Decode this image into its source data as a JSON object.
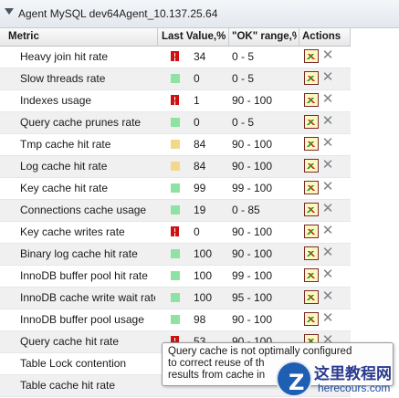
{
  "window": {
    "title": "Agent MySQL dev64Agent_10.137.25.64"
  },
  "table": {
    "headers": {
      "metric": "Metric",
      "last_value": "Last Value,%",
      "ok_range": "\"OK\" range,%",
      "actions": "Actions"
    },
    "rows": [
      {
        "metric": "Heavy join hit rate",
        "status": "red",
        "value": "34",
        "range": "0 - 5"
      },
      {
        "metric": "Slow threads rate",
        "status": "green",
        "value": "0",
        "range": "0 - 5"
      },
      {
        "metric": "Indexes usage",
        "status": "red",
        "value": "1",
        "range": "90 - 100"
      },
      {
        "metric": "Query cache prunes rate",
        "status": "green",
        "value": "0",
        "range": "0 - 5"
      },
      {
        "metric": "Tmp cache hit rate",
        "status": "yellow",
        "value": "84",
        "range": "90 - 100"
      },
      {
        "metric": "Log cache hit rate",
        "status": "yellow",
        "value": "84",
        "range": "90 - 100"
      },
      {
        "metric": "Key cache hit rate",
        "status": "green",
        "value": "99",
        "range": "99 - 100"
      },
      {
        "metric": "Connections cache usage",
        "status": "green",
        "value": "19",
        "range": "0 - 85"
      },
      {
        "metric": "Key cache writes rate",
        "status": "red",
        "value": "0",
        "range": "90 - 100"
      },
      {
        "metric": "Binary log cache hit rate",
        "status": "green",
        "value": "100",
        "range": "90 - 100"
      },
      {
        "metric": "InnoDB buffer pool hit rate",
        "status": "green",
        "value": "100",
        "range": "99 - 100"
      },
      {
        "metric": "InnoDB cache write wait rate",
        "status": "green",
        "value": "100",
        "range": "95 - 100"
      },
      {
        "metric": "InnoDB buffer pool usage",
        "status": "green",
        "value": "98",
        "range": "90 - 100"
      },
      {
        "metric": "Query cache hit rate",
        "status": "red",
        "value": "53",
        "range": "90 - 100"
      },
      {
        "metric": "Table Lock contention",
        "status": "none",
        "value": "",
        "range": ""
      },
      {
        "metric": "Table cache hit rate",
        "status": "none",
        "value": "",
        "range": ""
      }
    ]
  },
  "tooltip": {
    "line1": "Query cache is not optimally configured",
    "line2": "to correct reuse of th",
    "line3": "results from cache in"
  },
  "watermark": {
    "site_name": "这里教程网",
    "url": "herecours.com"
  },
  "colors": {
    "ok": "#8fe3a2",
    "warning": "#f2d98a",
    "critical": "#cc1111"
  },
  "icons": {
    "chart": "chart-icon",
    "delete": "delete-icon",
    "collapse": "collapse-arrow-icon"
  }
}
